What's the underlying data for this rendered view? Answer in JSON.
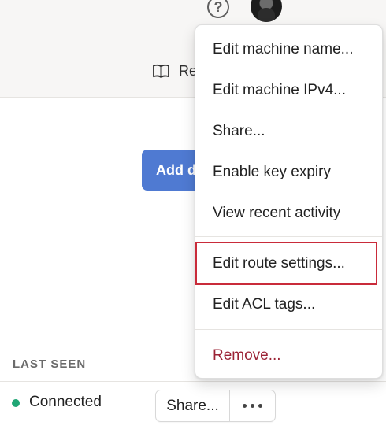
{
  "topbar": {
    "help_icon": "question-circle-icon",
    "avatar_icon": "user-avatar",
    "readme": {
      "icon": "book-icon",
      "label": "Re"
    }
  },
  "main": {
    "add_button_label": "Add d"
  },
  "table": {
    "last_seen_header": "LAST SEEN",
    "status": "Connected",
    "share_label": "Share...",
    "more_icon": "ellipsis-icon"
  },
  "menu": {
    "items": [
      "Edit machine name...",
      "Edit machine IPv4...",
      "Share...",
      "Enable key expiry",
      "View recent activity",
      "Edit route settings...",
      "Edit ACL tags...",
      "Remove..."
    ],
    "highlighted_item": "Edit route settings..."
  },
  "colors": {
    "accent": "#4f7ad2",
    "status_connected": "#20a675",
    "remove_text": "#9b2335",
    "highlight_border": "#c92b3a"
  }
}
